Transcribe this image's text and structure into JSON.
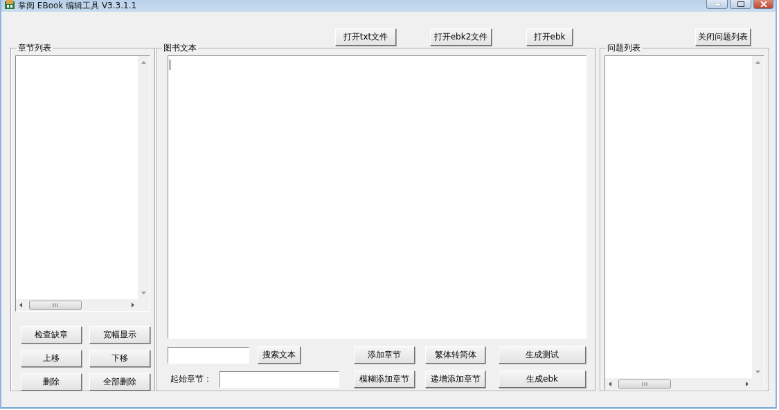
{
  "window": {
    "title": "掌阅 EBook 编辑工具 V3.3.1.1"
  },
  "toolbar": {
    "buttons": [
      "打开txt文件",
      "打开ebk2文件",
      "打开ebk"
    ],
    "close_issues_button": "关闭问题列表"
  },
  "chapter_list": {
    "title": "章节列表",
    "buttons": [
      "检查缺章",
      "宽幅显示",
      "上移",
      "下移",
      "删除",
      "全部删除"
    ]
  },
  "book_text": {
    "title": "图书文本",
    "search_button": "搜索文本",
    "start_chapter_label": "起始章节：",
    "buttons": [
      [
        "添加章节",
        "繁体转简体",
        "生成测试"
      ],
      [
        "模糊添加章节",
        "递增添加章节",
        "生成ebk"
      ]
    ]
  },
  "issue_list": {
    "title": "问题列表"
  }
}
